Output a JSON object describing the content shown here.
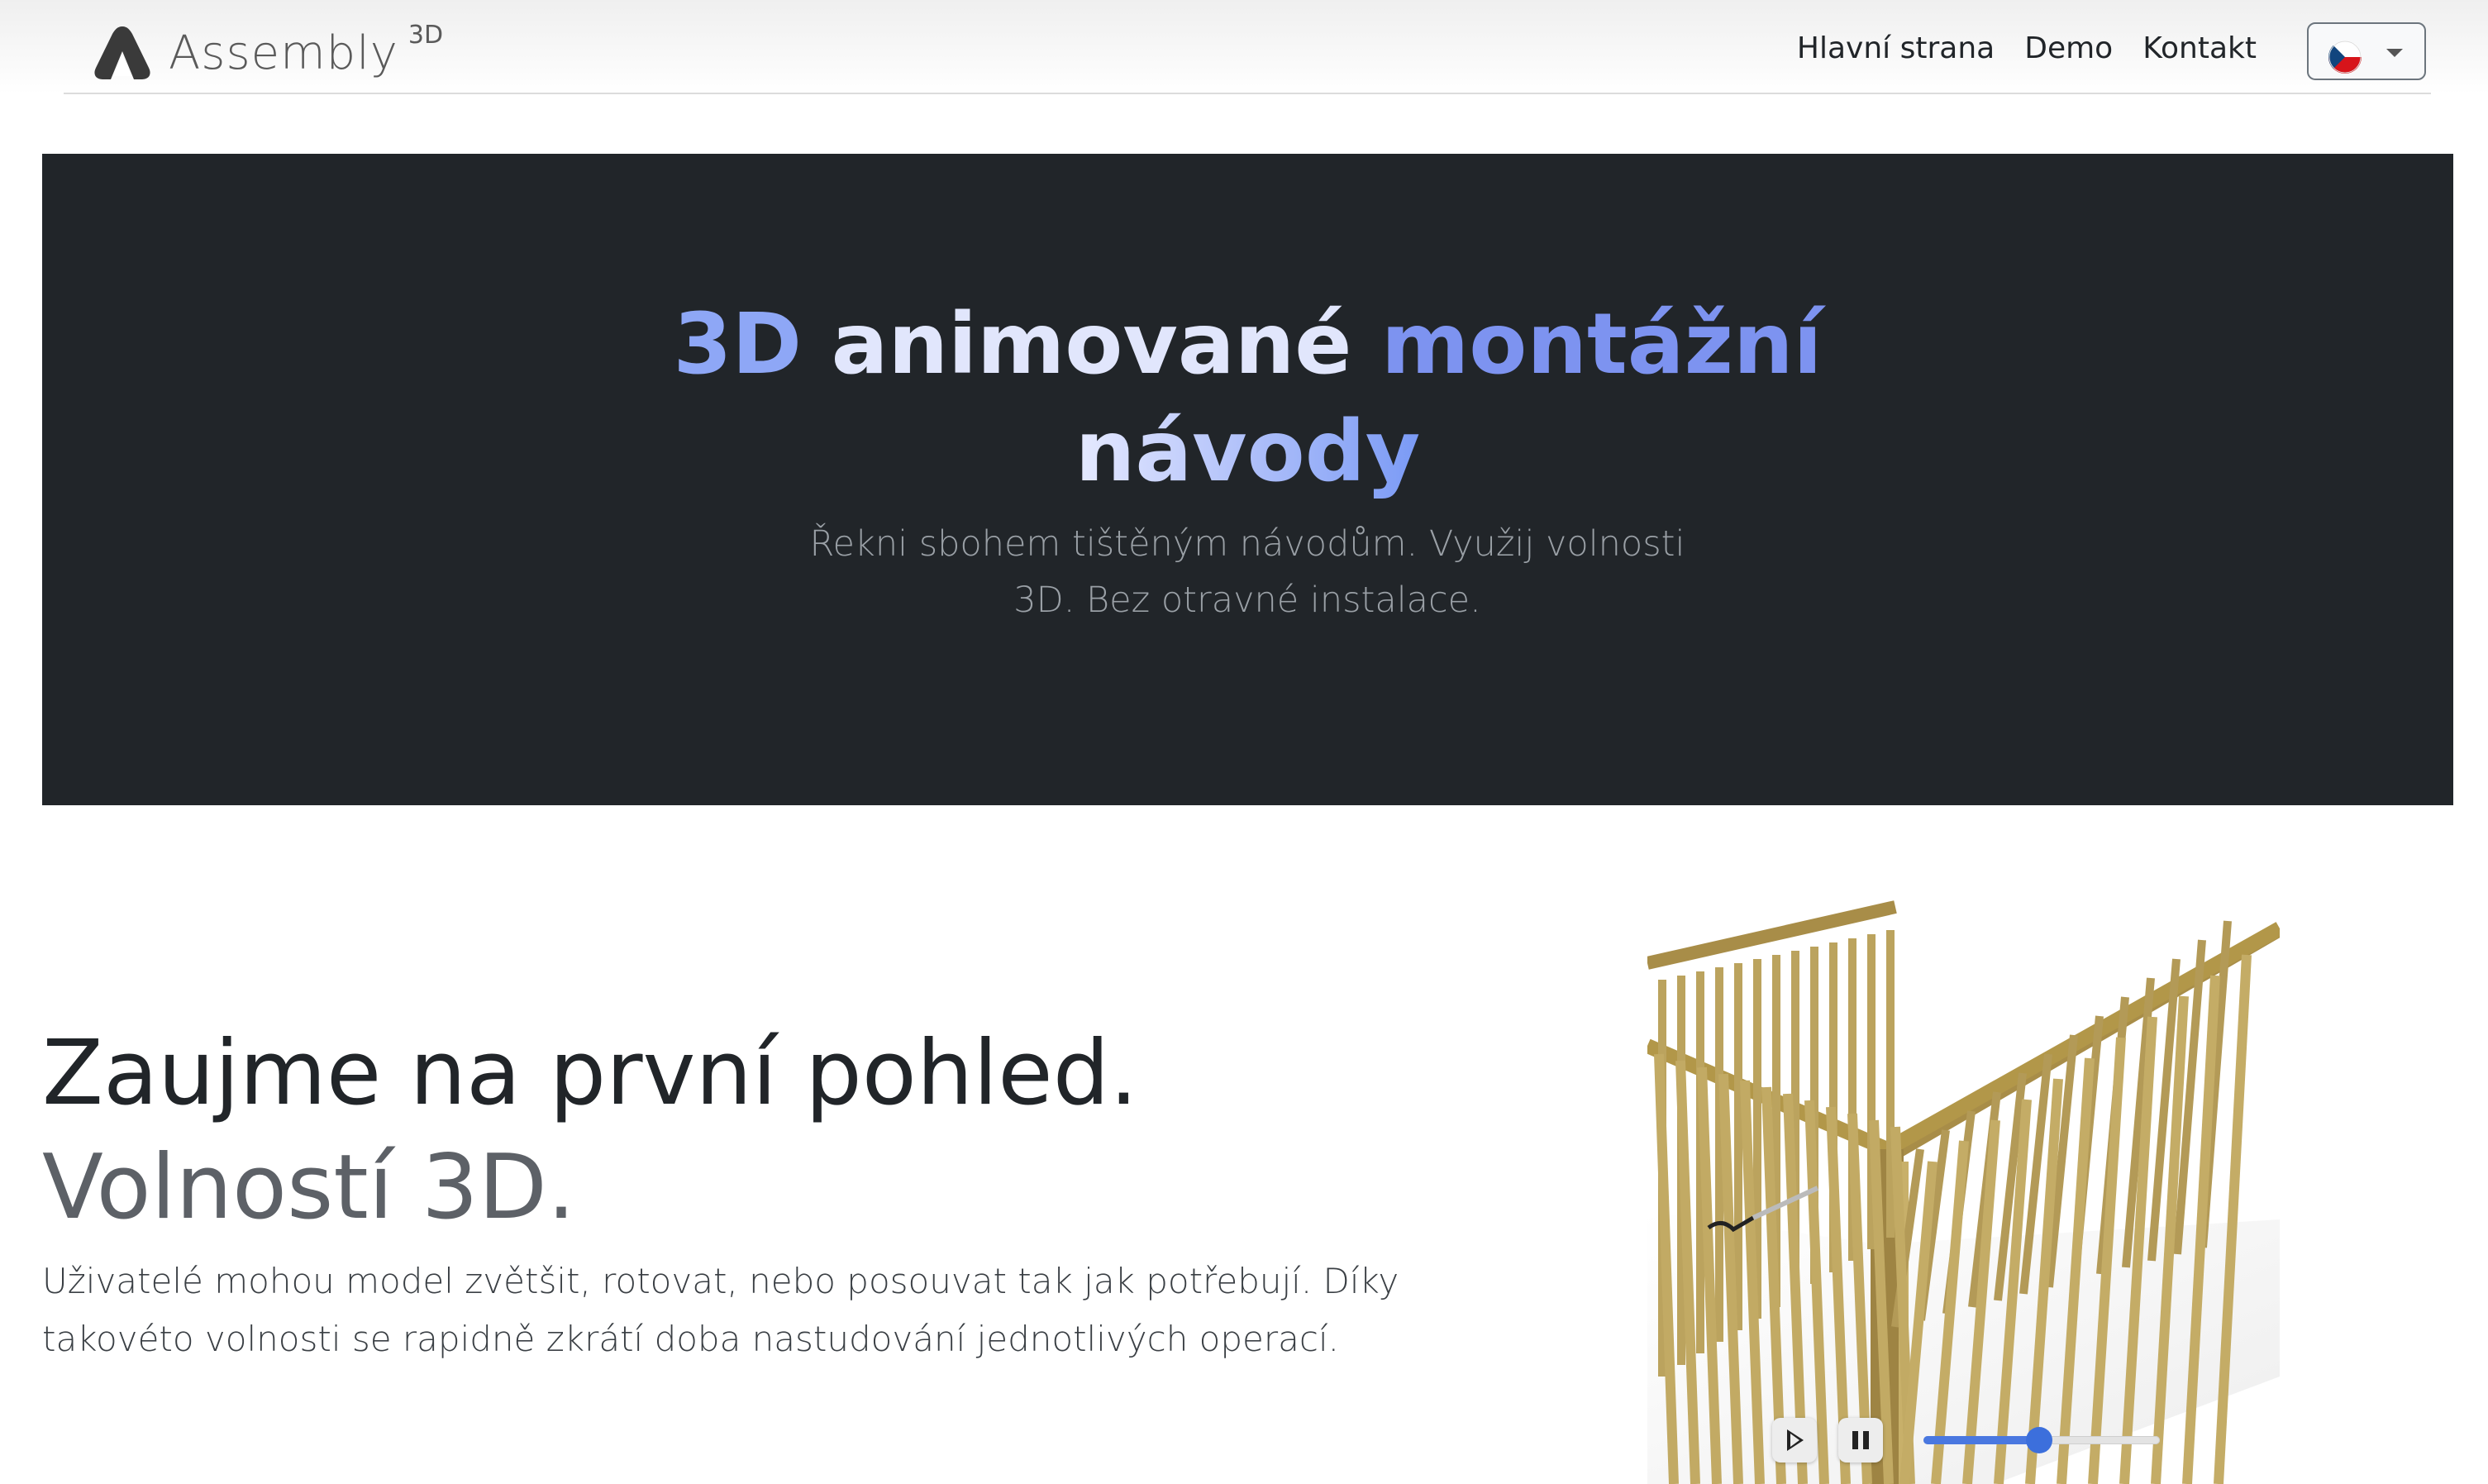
{
  "navbar": {
    "brand_name": "Assembly",
    "brand_suffix": "3D",
    "links": [
      "Hlavní strana",
      "Demo",
      "Kontakt"
    ],
    "language": {
      "selected": "CZ"
    }
  },
  "hero": {
    "title_words": [
      "3D",
      "animované",
      "montážní",
      "návody"
    ],
    "subtitle": "Řekni sbohem tištěným návodům. Využij volnosti 3D. Bez otravné instalace."
  },
  "feature": {
    "heading_main": "Zaujme na první pohled.",
    "heading_muted": "Volností 3D.",
    "text": "Uživatelé mohou model zvětšit, rotovat, nebo posouvat tak jak potřebují. Díky takovéto volnosti se rapidně zkrátí doba nastudování jednotlivých operací."
  },
  "viewer": {
    "model": "crib-frame-icon",
    "progress": 0.49
  },
  "colors": {
    "hero_bg": "#212529",
    "accent_blue": "#7d93f0",
    "wood": "#b8a05c",
    "slider": "#3c6fdc"
  }
}
